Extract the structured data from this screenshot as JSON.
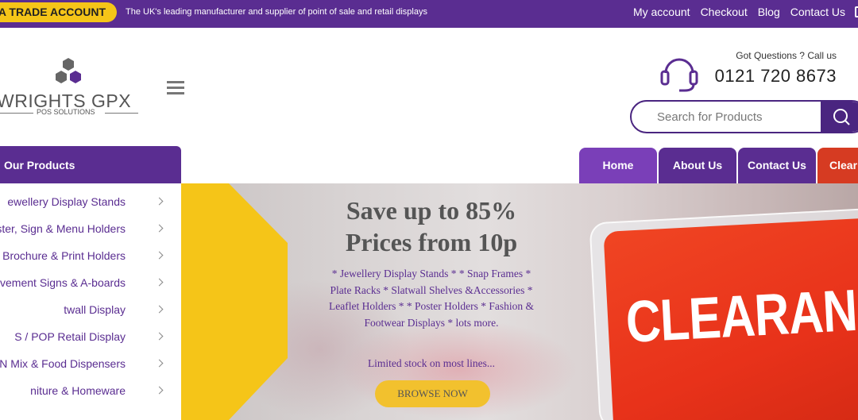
{
  "topbar": {
    "trade_button": "N A TRADE ACCOUNT",
    "tagline": "The UK's leading manufacturer and supplier of point of sale and retail displays",
    "links": [
      "My account",
      "Checkout",
      "Blog",
      "Contact Us"
    ]
  },
  "header": {
    "logo_text": "WRIGHTS GPX",
    "logo_subtext": "POS SOLUTIONS",
    "help_label": "Got Questions ? Call us",
    "phone": "0121 720 8673",
    "search_placeholder": "Search for Products"
  },
  "products": {
    "heading": "Our Products",
    "items": [
      "ewellery Display Stands",
      "ster, Sign & Menu Holders",
      "aflet Brochure & Print Holders",
      "vement Signs & A-boards",
      "twall Display",
      "S / POP Retail Display",
      "k N Mix & Food Dispensers",
      "niture & Homeware"
    ]
  },
  "nav": {
    "tabs": [
      "Home",
      "About Us",
      "Contact Us",
      "Clear"
    ]
  },
  "banner": {
    "headline_1": "Save up to 85%",
    "headline_2": "Prices from 10p",
    "description": "* Jewellery Display Stands * * Snap Frames * Plate Racks * Slatwall Shelves &Accessories * Leaflet Holders * * Poster Holders * Fashion & Footwear Displays * lots more.",
    "limited": "Limited stock on most lines...",
    "button": "BROWSE NOW",
    "sign_text": "CLEARANC"
  },
  "colors": {
    "brand_purple": "#5a2d91",
    "accent_yellow": "#f5c518",
    "clearance_red": "#d63b22"
  }
}
